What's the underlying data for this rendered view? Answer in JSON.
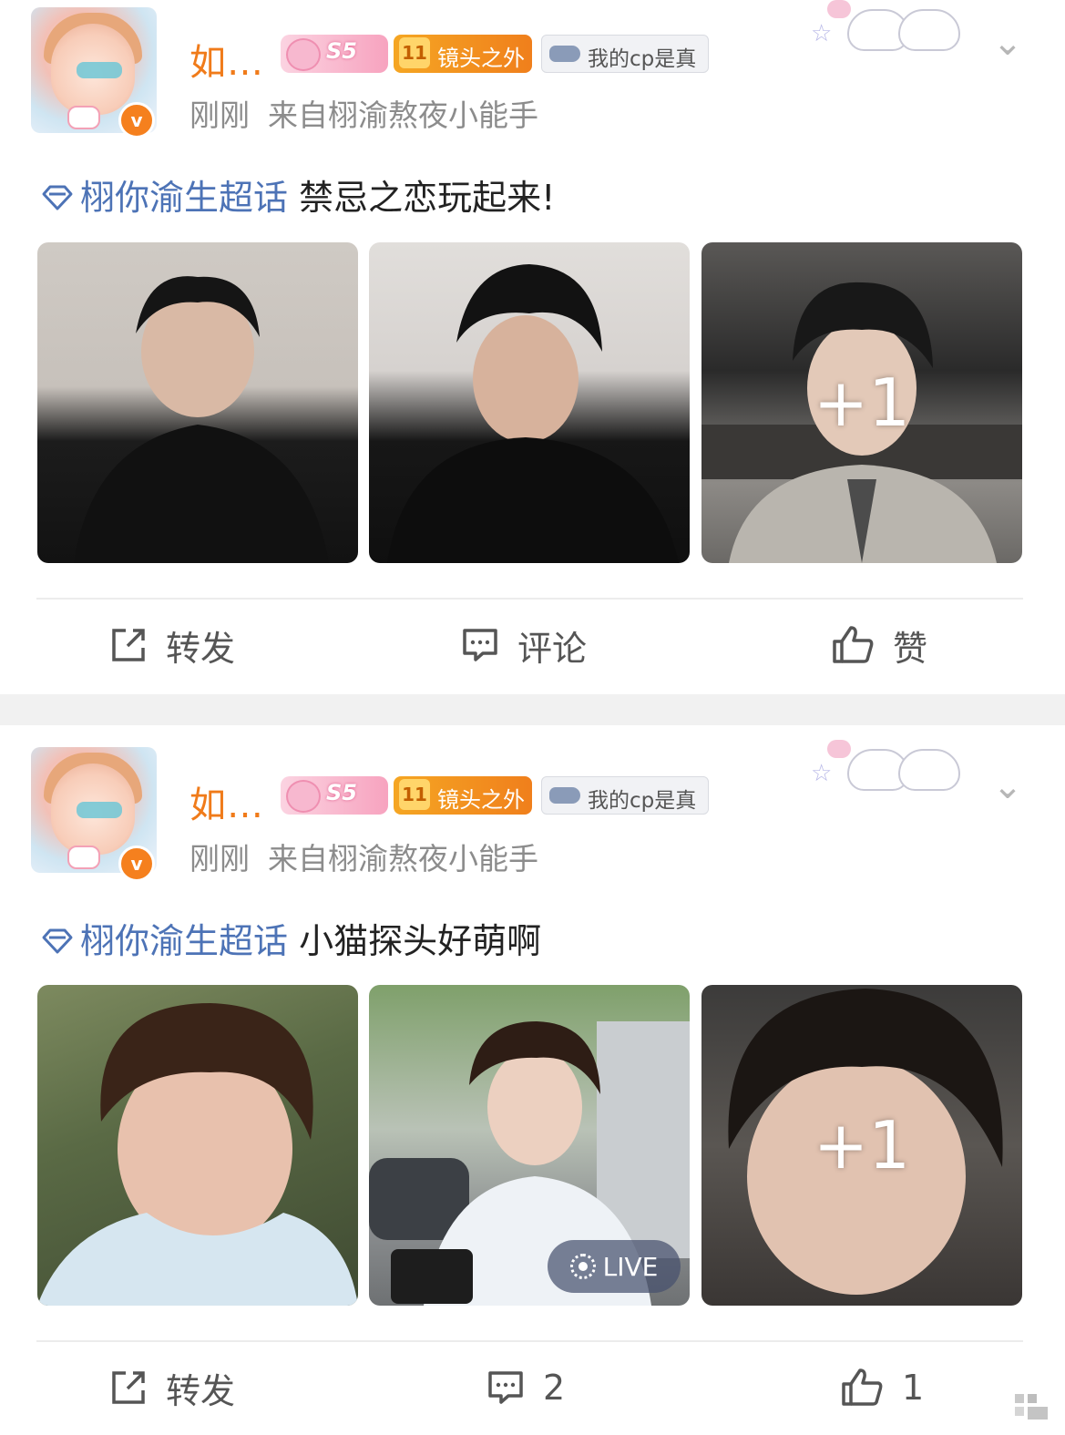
{
  "posts": [
    {
      "user": {
        "name": "如…",
        "badge_level_text": "S5",
        "level_num": "11",
        "level_label": "镜头之外",
        "fan_label": "我的cp是真"
      },
      "meta": {
        "time": "刚刚",
        "source": "来自栩渝熬夜小能手"
      },
      "content": {
        "tag": "栩你渝生超话",
        "text": " 禁忌之恋玩起来!"
      },
      "images": [
        {
          "overlay": ""
        },
        {
          "overlay": ""
        },
        {
          "overlay": "+1"
        }
      ],
      "actions": {
        "repost": "转发",
        "comment": "评论",
        "like": "赞"
      }
    },
    {
      "user": {
        "name": "如…",
        "badge_level_text": "S5",
        "level_num": "11",
        "level_label": "镜头之外",
        "fan_label": "我的cp是真"
      },
      "meta": {
        "time": "刚刚",
        "source": "来自栩渝熬夜小能手"
      },
      "content": {
        "tag": "栩你渝生超话",
        "text": " 小猫探头好萌啊"
      },
      "images": [
        {
          "overlay": ""
        },
        {
          "overlay": "LIVE"
        },
        {
          "overlay": "+1"
        }
      ],
      "actions": {
        "repost": "转发",
        "comment": "2",
        "like": "1"
      }
    }
  ],
  "colors": {
    "username": "#f07b1a",
    "topic_link": "#4d73b6",
    "meta": "#8c8c8c",
    "separator": "#f1f1f1"
  },
  "icons": [
    "more-chevron-icon",
    "verified-v-icon",
    "repost-icon",
    "comment-icon",
    "like-icon",
    "diamond-topic-icon",
    "live-photo-icon"
  ]
}
